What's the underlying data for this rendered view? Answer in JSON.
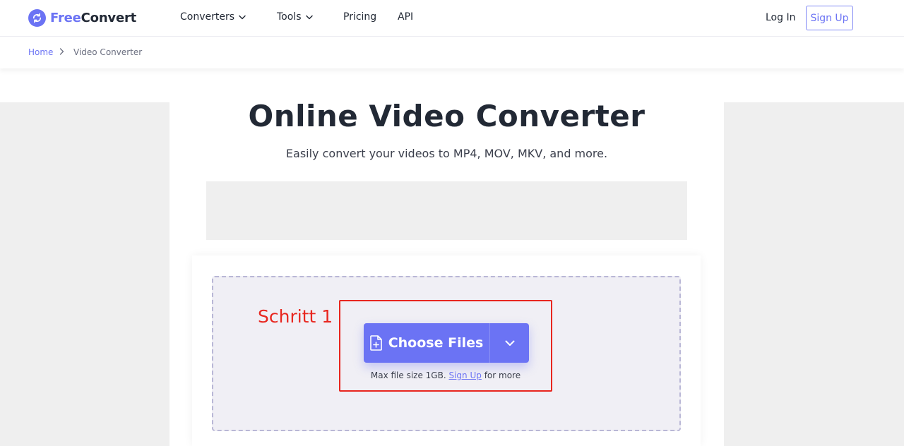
{
  "brand": {
    "name_part1": "Free",
    "name_part2": "Convert",
    "color": "#6b73f4"
  },
  "nav": {
    "converters": "Converters",
    "tools": "Tools",
    "pricing": "Pricing",
    "api": "API",
    "login": "Log In",
    "signup": "Sign Up"
  },
  "breadcrumb": {
    "home": "Home",
    "current": "Video Converter"
  },
  "hero": {
    "title": "Online Video Converter",
    "subtitle": "Easily convert your videos to MP4, MOV, MKV, and more."
  },
  "upload": {
    "annotation": "Schritt 1",
    "choose_label": "Choose Files",
    "note_prefix": "Max file size 1GB.",
    "note_link": "Sign Up",
    "note_suffix": "for more"
  },
  "colors": {
    "accent": "#6b73f4",
    "annotation": "#e8261f",
    "dropzone_bg": "#f0eff5"
  },
  "icons": [
    "sync-icon",
    "chevron-down-icon",
    "chevron-right-icon",
    "file-plus-icon"
  ]
}
